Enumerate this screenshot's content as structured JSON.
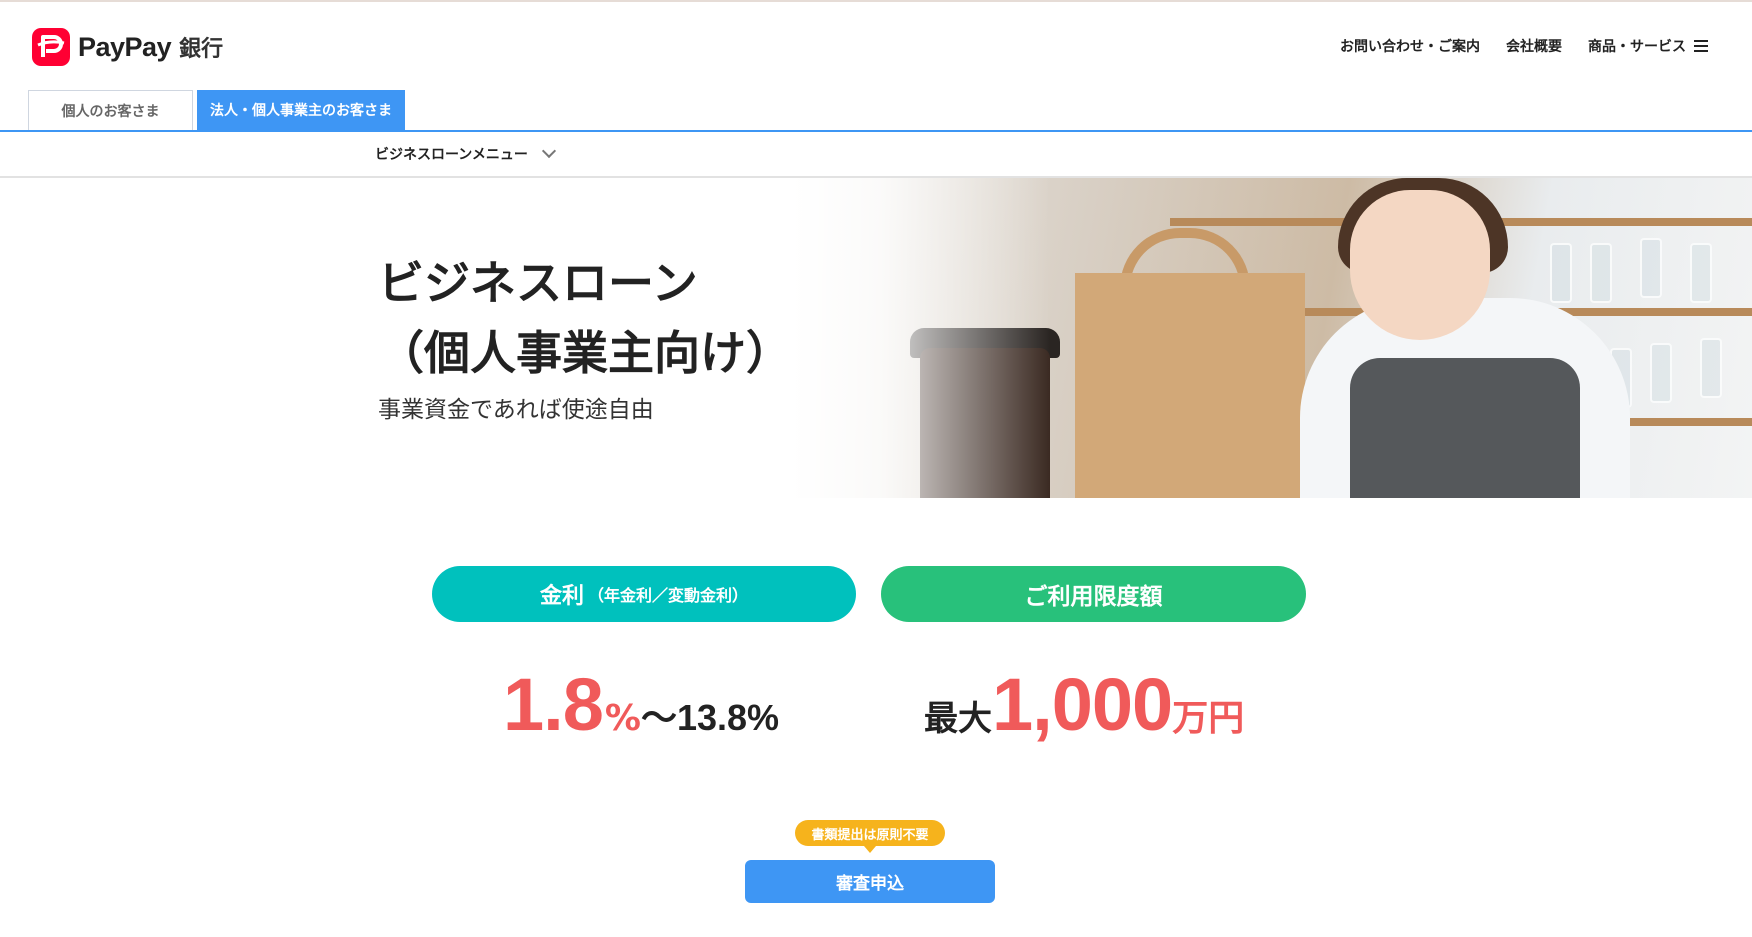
{
  "brand": {
    "name": "PayPay",
    "suffix": "銀行"
  },
  "header": {
    "nav": [
      "お問い合わせ・ご案内",
      "会社概要"
    ],
    "products_label": "商品・サービス"
  },
  "tabs": {
    "personal": "個人のお客さま",
    "business": "法人・個人事業主のお客さま"
  },
  "submenu": {
    "label": "ビジネスローンメニュー"
  },
  "hero": {
    "title_line1": "ビジネスローン",
    "title_line2": "（個人事業主向け）",
    "subtitle": "事業資金であれば使途自由"
  },
  "rate": {
    "pill_label": "金利",
    "pill_small": "（年金利／変動金利）",
    "min_value": "1.8",
    "min_unit": "%",
    "max_text": "〜13.8%"
  },
  "limit": {
    "pill_label": "ご利用限度額",
    "prefix": "最大",
    "value": "1,000",
    "unit": "万円"
  },
  "cta": {
    "badge": "書類提出は原則不要",
    "button": "審査申込"
  },
  "colors": {
    "brand_red": "#ff0033",
    "tab_blue": "#3e96f4",
    "rate_teal": "#00c1bd",
    "limit_green": "#28c17b",
    "value_red": "#f05a5a",
    "badge_yellow": "#f6b31c"
  }
}
